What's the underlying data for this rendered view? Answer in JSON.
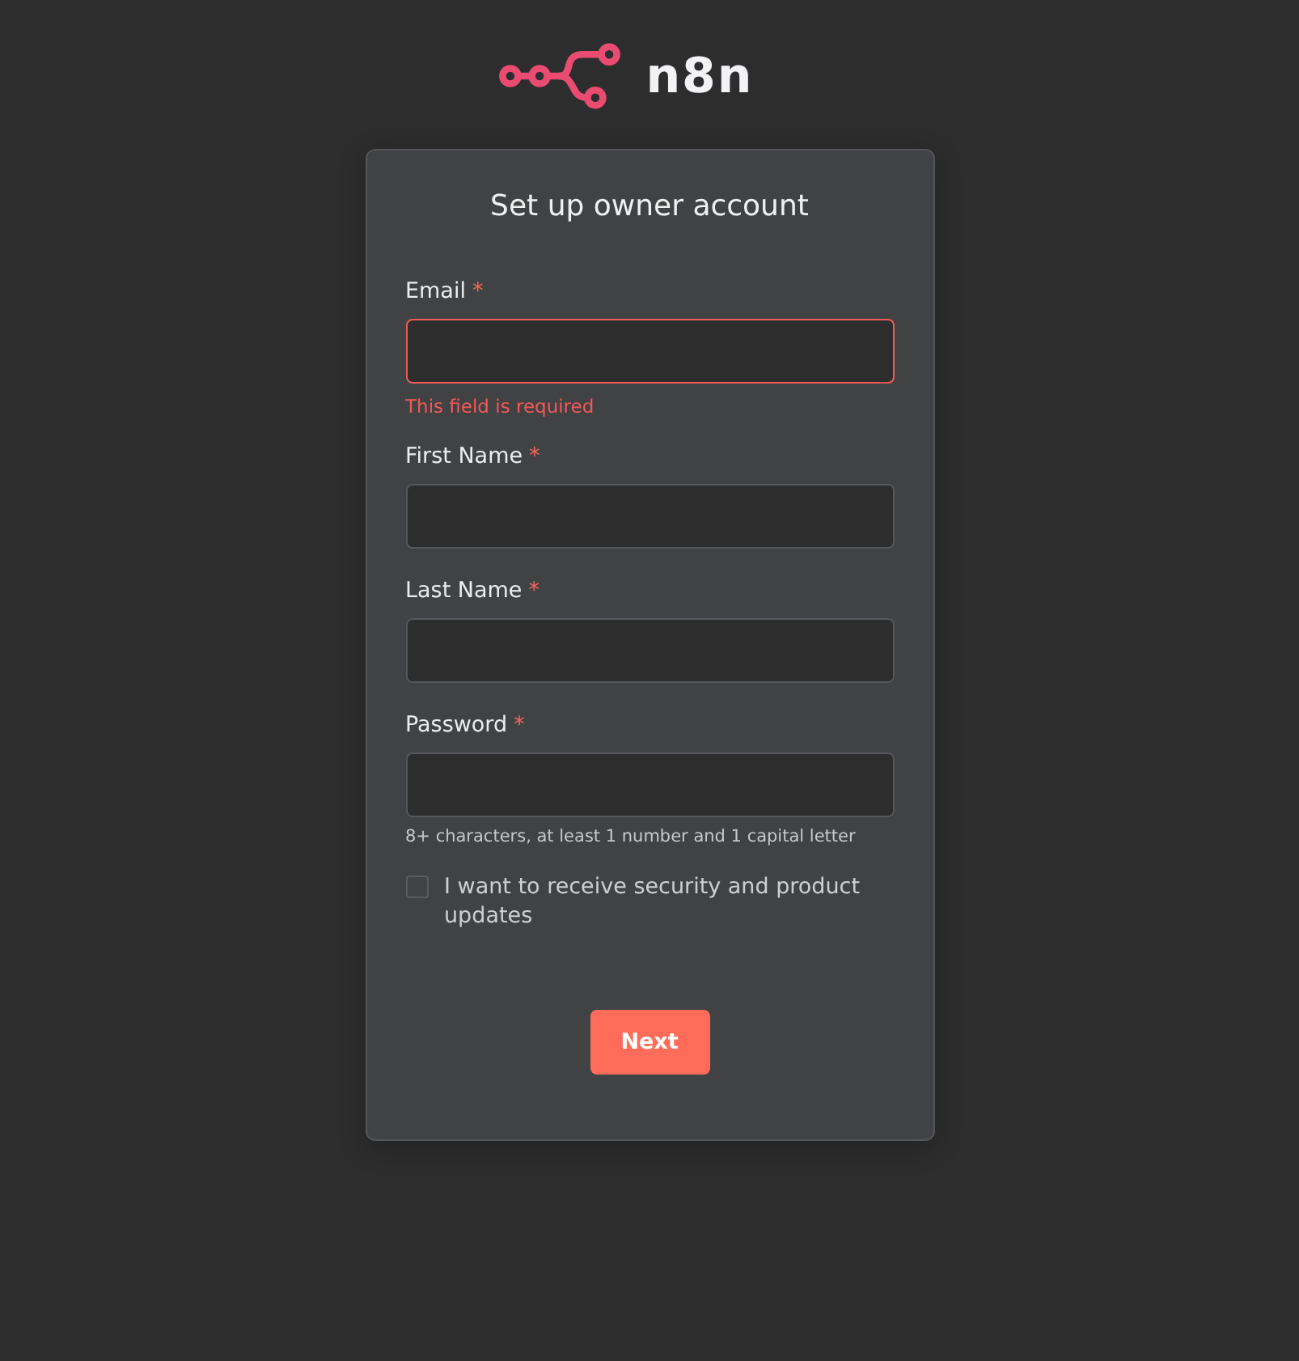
{
  "logo": {
    "text": "n8n"
  },
  "form": {
    "title": "Set up owner account",
    "fields": [
      {
        "label": "Email",
        "required_mark": "*",
        "invalid": true,
        "error": "This field is required"
      },
      {
        "label": "First Name",
        "required_mark": "*",
        "invalid": false
      },
      {
        "label": "Last Name",
        "required_mark": "*",
        "invalid": false
      },
      {
        "label": "Password",
        "required_mark": "*",
        "invalid": false,
        "hint": "8+ characters, at least 1 number and 1 capital letter"
      }
    ],
    "checkbox": {
      "label": "I want to receive security and product updates",
      "checked": false
    },
    "submit": {
      "label": "Next"
    }
  }
}
